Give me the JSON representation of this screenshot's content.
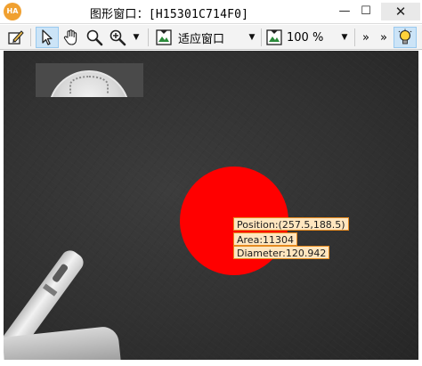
{
  "window": {
    "app_icon_text": "HA",
    "title": "图形窗口：[H15301C714F0]",
    "minimize_glyph": "—",
    "maximize_glyph": "☐",
    "close_glyph": "✕"
  },
  "toolbar": {
    "icons": [
      "edit-icon",
      "pointer-icon",
      "hand-pan-icon",
      "magnifier-icon",
      "zoom-in-icon",
      "fit-window-icon",
      "zoom-percent-icon",
      "lightbulb-icon"
    ],
    "fit_mode_label": "适应窗口",
    "zoom_label": "100 %",
    "overflow_glyph": "»"
  },
  "view": {
    "overlay": {
      "position_text": "Position:(257.5,188.5)",
      "area_text": "Area:11304",
      "diameter_text": "Diameter:120.942"
    },
    "region_color": "#ff0000",
    "label_bg": "#ffe6bf",
    "label_border": "#e58a1f"
  }
}
